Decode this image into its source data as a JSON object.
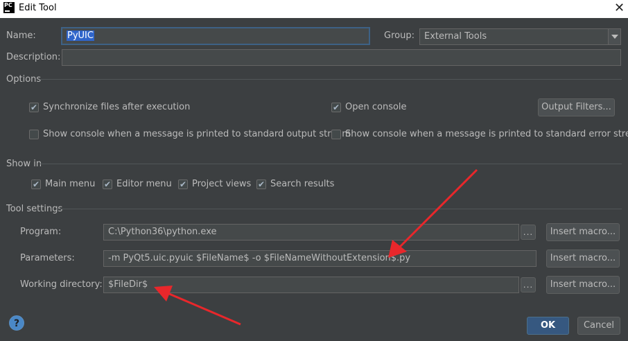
{
  "window": {
    "title": "Edit Tool",
    "app_icon_text": "PC"
  },
  "name": {
    "label": "Name:",
    "value": "PyUIC"
  },
  "group": {
    "label": "Group:",
    "value": "External Tools"
  },
  "description": {
    "label": "Description:",
    "value": ""
  },
  "options": {
    "heading": "Options",
    "sync_files": {
      "label": "Synchronize files after execution",
      "checked": true
    },
    "open_console": {
      "label": "Open console",
      "checked": true
    },
    "output_filters": "Output Filters...",
    "show_console_stdout": {
      "label": "Show console when a message is printed to standard output stream",
      "checked": false
    },
    "show_console_stderr": {
      "label": "Show console when a message is printed to standard error stream",
      "checked": false
    }
  },
  "show_in": {
    "heading": "Show in",
    "items": [
      {
        "label": "Main menu",
        "checked": true
      },
      {
        "label": "Editor menu",
        "checked": true
      },
      {
        "label": "Project views",
        "checked": true
      },
      {
        "label": "Search results",
        "checked": true
      }
    ]
  },
  "tool_settings": {
    "heading": "Tool settings",
    "program": {
      "label": "Program:",
      "value": "C:\\Python36\\python.exe"
    },
    "parameters": {
      "label": "Parameters:",
      "value": "-m PyQt5.uic.pyuic  $FileName$ -o $FileNameWithoutExtension$.py"
    },
    "working_directory": {
      "label": "Working directory:",
      "value": "$FileDir$"
    },
    "browse": "...",
    "insert_macro": "Insert macro..."
  },
  "buttons": {
    "ok": "OK",
    "cancel": "Cancel",
    "help": "?"
  },
  "colors": {
    "background": "#3c3f41",
    "accent": "#365880",
    "arrow": "#e8272b"
  }
}
